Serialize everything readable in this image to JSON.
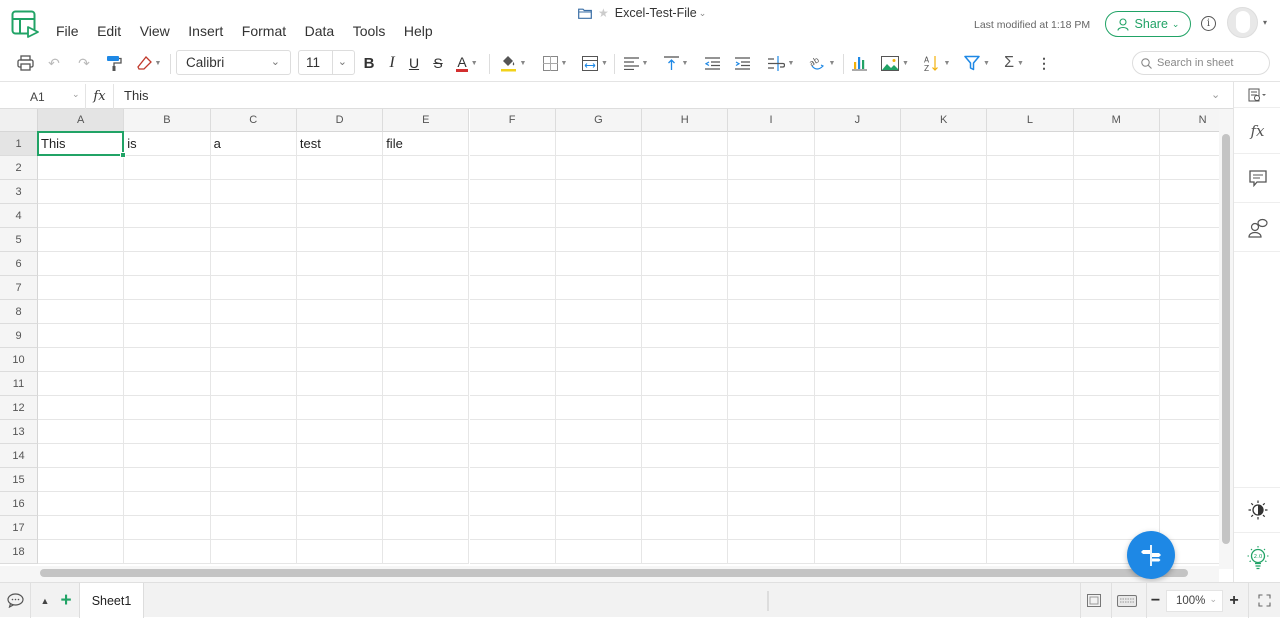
{
  "app": {
    "menu": [
      "File",
      "Edit",
      "View",
      "Insert",
      "Format",
      "Data",
      "Tools",
      "Help"
    ],
    "file_title": "Excel-Test-File",
    "title_dropdown": "⌄",
    "last_modified": "Last modified at 1:18 PM",
    "share_label": "Share",
    "info_glyph": "i",
    "colors": {
      "accent": "#21a366",
      "fab": "#1e88e5",
      "font_color_underline": "#d32f2f",
      "fill_color_underline": "#f2d21a"
    }
  },
  "toolbar": {
    "font_name": "Calibri",
    "font_size": "11",
    "bold": "B",
    "italic": "I",
    "underline": "U",
    "strike": "S",
    "font_color": "A",
    "sum": "Σ",
    "more": "⋮",
    "search_placeholder": "Search in sheet"
  },
  "formula_bar": {
    "cell_ref": "A1",
    "fx": "fx",
    "value": "This"
  },
  "sheet": {
    "columns": [
      "A",
      "B",
      "C",
      "D",
      "E",
      "F",
      "G",
      "H",
      "I",
      "J",
      "K",
      "L",
      "M",
      "N"
    ],
    "rows": [
      "1",
      "2",
      "3",
      "4",
      "5",
      "6",
      "7",
      "8",
      "9",
      "10",
      "11",
      "12",
      "13",
      "14",
      "15",
      "16",
      "17",
      "18"
    ],
    "cells": {
      "A1": "This",
      "B1": "is",
      "C1": "a",
      "D1": "test",
      "E1": "file"
    },
    "selected_cell": "A1"
  },
  "right_panel": {
    "fx_label": "fx"
  },
  "bottom": {
    "sheet_tabs": [
      "Sheet1"
    ],
    "add_sheet": "+",
    "zoom_level": "100%",
    "zoom_minus": "−",
    "zoom_plus": "+",
    "bulb_label": "2.0"
  }
}
